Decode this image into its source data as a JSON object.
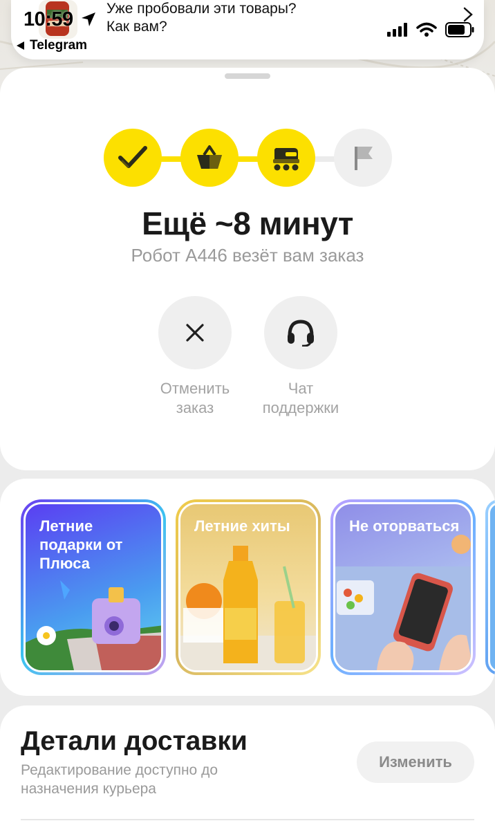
{
  "status_bar": {
    "time": "10:59",
    "back_app": "Telegram"
  },
  "notification": {
    "line1": "Уже пробовали эти товары?",
    "line2": "Как вам?"
  },
  "order": {
    "steps": [
      {
        "icon": "check-icon",
        "active": true
      },
      {
        "icon": "basket-icon",
        "active": true
      },
      {
        "icon": "robot-icon",
        "active": true
      },
      {
        "icon": "flag-icon",
        "active": false
      }
    ],
    "eta_title": "Ещё ~8 минут",
    "eta_subtitle": "Робот А446 везёт вам заказ",
    "actions": {
      "cancel_line1": "Отменить",
      "cancel_line2": "заказ",
      "support_line1": "Чат",
      "support_line2": "поддержки"
    }
  },
  "stories": [
    {
      "title": "Летние подарки от Плюса"
    },
    {
      "title": "Летние хиты"
    },
    {
      "title": "Не оторваться"
    }
  ],
  "delivery_details": {
    "title": "Детали доставки",
    "subtitle": "Редактирование доступно до назначения курьера",
    "edit_label": "Изменить"
  },
  "colors": {
    "accent_yellow": "#fce000",
    "inactive_gray": "#efefef"
  }
}
